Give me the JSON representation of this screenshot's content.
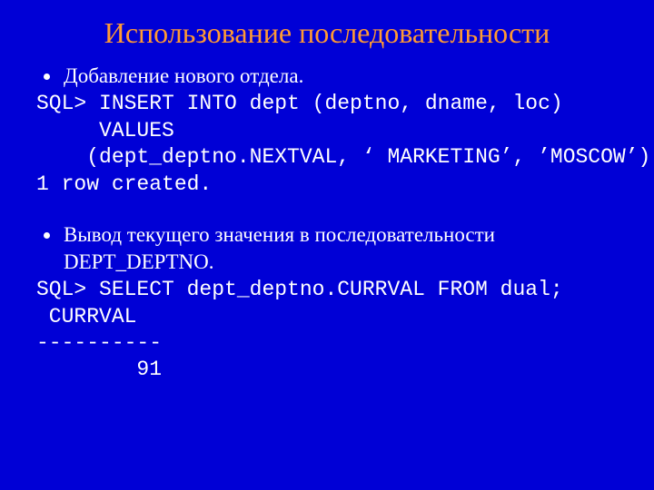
{
  "title": "Использование последовательности",
  "bullet1": "Добавление нового отдела.",
  "code1_l1": "SQL> INSERT INTO dept (deptno, dname, loc)",
  "code1_l2": "     VALUES",
  "code1_l3": "    (dept_deptno.NEXTVAL, ‘ MARKETING’, ’MOSCOW’);",
  "code1_l4": "1 row created.",
  "bullet2": "Вывод текущего значения в последовательности DEPT_DEPTNO.",
  "code2_l1": "SQL> SELECT dept_deptno.CURRVAL FROM dual;",
  "code2_l2": " CURRVAL",
  "code2_l3": "----------",
  "code2_l4": "        91"
}
